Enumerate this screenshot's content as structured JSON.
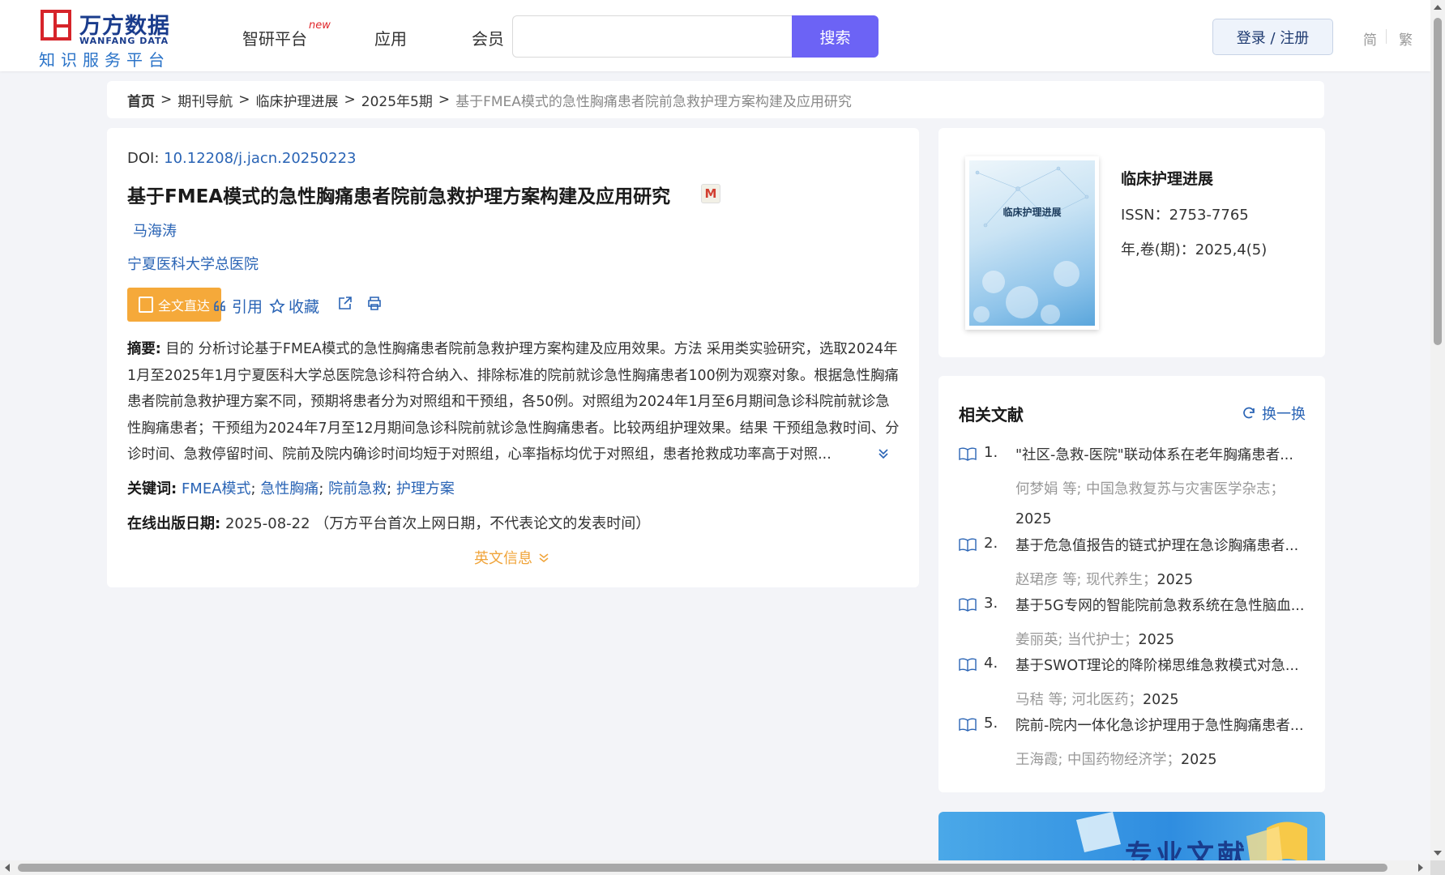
{
  "header": {
    "logo_cn": "万方数据",
    "logo_en": "WANFANG DATA",
    "logo_sub": "知识服务平台",
    "nav": [
      "智研平台",
      "应用",
      "会员"
    ],
    "nav_new_badge": "new",
    "search_placeholder": "",
    "search_button": "搜索",
    "login_button": "登录 / 注册",
    "lang_simplified": "简",
    "lang_traditional": "繁"
  },
  "breadcrumb": {
    "items": [
      "首页",
      "期刊导航",
      "临床护理进展",
      "2025年5期"
    ],
    "current": "基于FMEA模式的急性胸痛患者院前急救护理方案构建及应用研究",
    "separator": ">"
  },
  "article": {
    "doi_label": "DOI:",
    "doi": "10.12208/j.jacn.20250223",
    "title": "基于FMEA模式的急性胸痛患者院前急救护理方案构建及应用研究",
    "badge": "M",
    "author": "马海涛",
    "affiliation": "宁夏医科大学总医院",
    "fulltext_button": "全文直达",
    "cite": "引用",
    "favorite": "收藏",
    "abstract_label": "摘要:",
    "abstract": "目的 分析讨论基于FMEA模式的急性胸痛患者院前急救护理方案构建及应用效果。方法 采用类实验研究，选取2024年1月至2025年1月宁夏医科大学总医院急诊科符合纳入、排除标准的院前就诊急性胸痛患者100例为观察对象。根据急性胸痛患者院前急救护理方案不同，预期将患者分为对照组和干预组，各50例。对照组为2024年1月至6月期间急诊科院前就诊急性胸痛患者；干预组为2024年7月至12月期间急诊科院前就诊急性胸痛患者。比较两组护理效果。结果 干预组急救时间、分诊时间、急救停留时间、院前及院内确诊时间均短于对照组，心率指标均优于对照组，患者抢救成功率高于对照...",
    "keywords_label": "关键词:",
    "keywords": [
      "FMEA模式",
      "急性胸痛",
      "院前急救",
      "护理方案"
    ],
    "pubdate_label": "在线出版日期:",
    "pubdate": "2025-08-22",
    "pubdate_note": "（万方平台首次上网日期，不代表论文的发表时间）",
    "en_info": "英文信息"
  },
  "journal": {
    "name": "临床护理进展",
    "cover_title": "临床护理进展",
    "issn": "ISSN：2753-7765",
    "volume": "年,卷(期)：2025,4(5)"
  },
  "related": {
    "title": "相关文献",
    "refresh": "换一换",
    "items": [
      {
        "num": "1.",
        "title": "\"社区-急救-医院\"联动体系在老年胸痛患者...",
        "meta": "何梦娟  等;  中国急救复苏与灾害医学杂志；",
        "year": "2025"
      },
      {
        "num": "2.",
        "title": "基于危急值报告的链式护理在急诊胸痛患者...",
        "meta": "赵珺彦  等;  现代养生；",
        "year": "2025"
      },
      {
        "num": "3.",
        "title": "基于5G专网的智能院前急救系统在急性脑血...",
        "meta": "姜丽英; 当代护士；",
        "year": "2025"
      },
      {
        "num": "4.",
        "title": "基于SWOT理论的降阶梯思维急救模式对急...",
        "meta": "马秸  等;  河北医药；",
        "year": "2025"
      },
      {
        "num": "5.",
        "title": "院前-院内一体化急诊护理用于急性胸痛患者...",
        "meta": "王海霞; 中国药物经济学；",
        "year": "2025"
      }
    ]
  },
  "banner": {
    "text": "专业文献"
  }
}
